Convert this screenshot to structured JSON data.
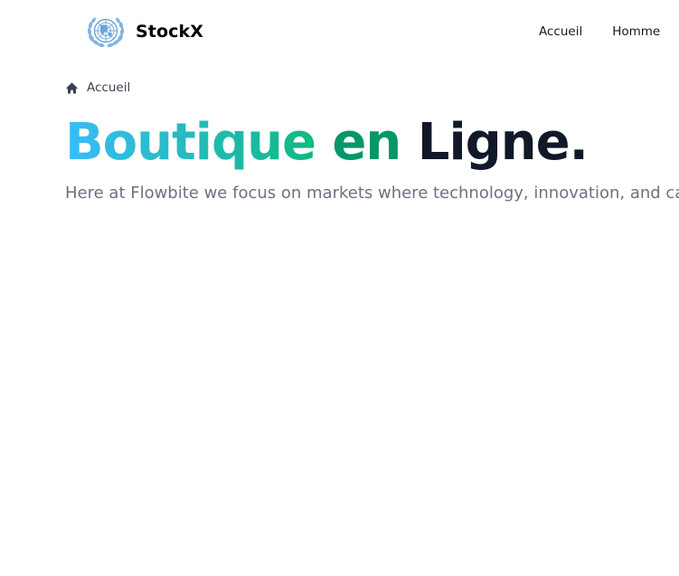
{
  "navbar": {
    "brand_name": "StockX",
    "links": [
      {
        "label": "Accueil"
      },
      {
        "label": "Homme"
      }
    ]
  },
  "breadcrumb": {
    "label": "Accueil"
  },
  "hero": {
    "title_part1": "Boutique",
    "title_part2": "en",
    "title_part3": "Ligne.",
    "text": "Here at Flowbite we focus on markets where technology, innovation, and capital can unlock long-term value and drive economic growth."
  },
  "colors": {
    "gradient_start": "#38bdf8",
    "gradient_end": "#10b981",
    "accent_green": "#059669",
    "title_dark": "#111827",
    "body_gray": "#6b7280"
  }
}
